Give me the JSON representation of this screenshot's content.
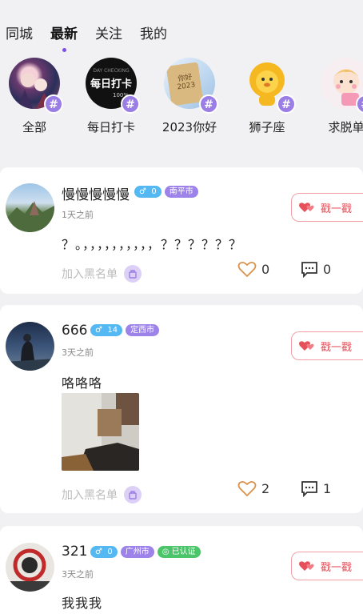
{
  "tabs": [
    {
      "label": "同城"
    },
    {
      "label": "最新"
    },
    {
      "label": "关注"
    },
    {
      "label": "我的"
    }
  ],
  "active_tab": "最新",
  "topics": [
    {
      "label": "全部",
      "badge": "#"
    },
    {
      "label": "每日打卡",
      "badge": "#",
      "image_text": "每日打卡",
      "image_subtext": "100%",
      "image_toptext": "DAY CHECKING"
    },
    {
      "label": "2023你好",
      "badge": "#",
      "image_text": "你好 2023"
    },
    {
      "label": "狮子座",
      "badge": "#"
    },
    {
      "label": "求脱单",
      "badge": "#"
    }
  ],
  "posts": [
    {
      "username": "慢慢慢慢慢",
      "gender": "♂",
      "age": "0",
      "city": "南平市",
      "time": "1天之前",
      "content": "？。，，，，，，，，，，？？？？？？",
      "poke_label": "戳一戳",
      "block_label": "加入黑名单",
      "likes": "0",
      "comments": "0"
    },
    {
      "username": "666",
      "gender": "♂",
      "age": "14",
      "city": "定西市",
      "time": "3天之前",
      "content": "咯咯咯",
      "poke_label": "戳一戳",
      "block_label": "加入黑名单",
      "likes": "2",
      "comments": "1"
    },
    {
      "username": "321",
      "gender": "♂",
      "age": "0",
      "city": "广州市",
      "verified": "已认证",
      "time": "3天之前",
      "content": "我我我",
      "poke_label": "戳一戳"
    }
  ],
  "colors": {
    "accent": "#7a4ee8",
    "gender_badge": "#54b8f2",
    "city_badge": "#9d82ea",
    "verified_badge": "#4cc56a",
    "poke": "#e6505a"
  }
}
